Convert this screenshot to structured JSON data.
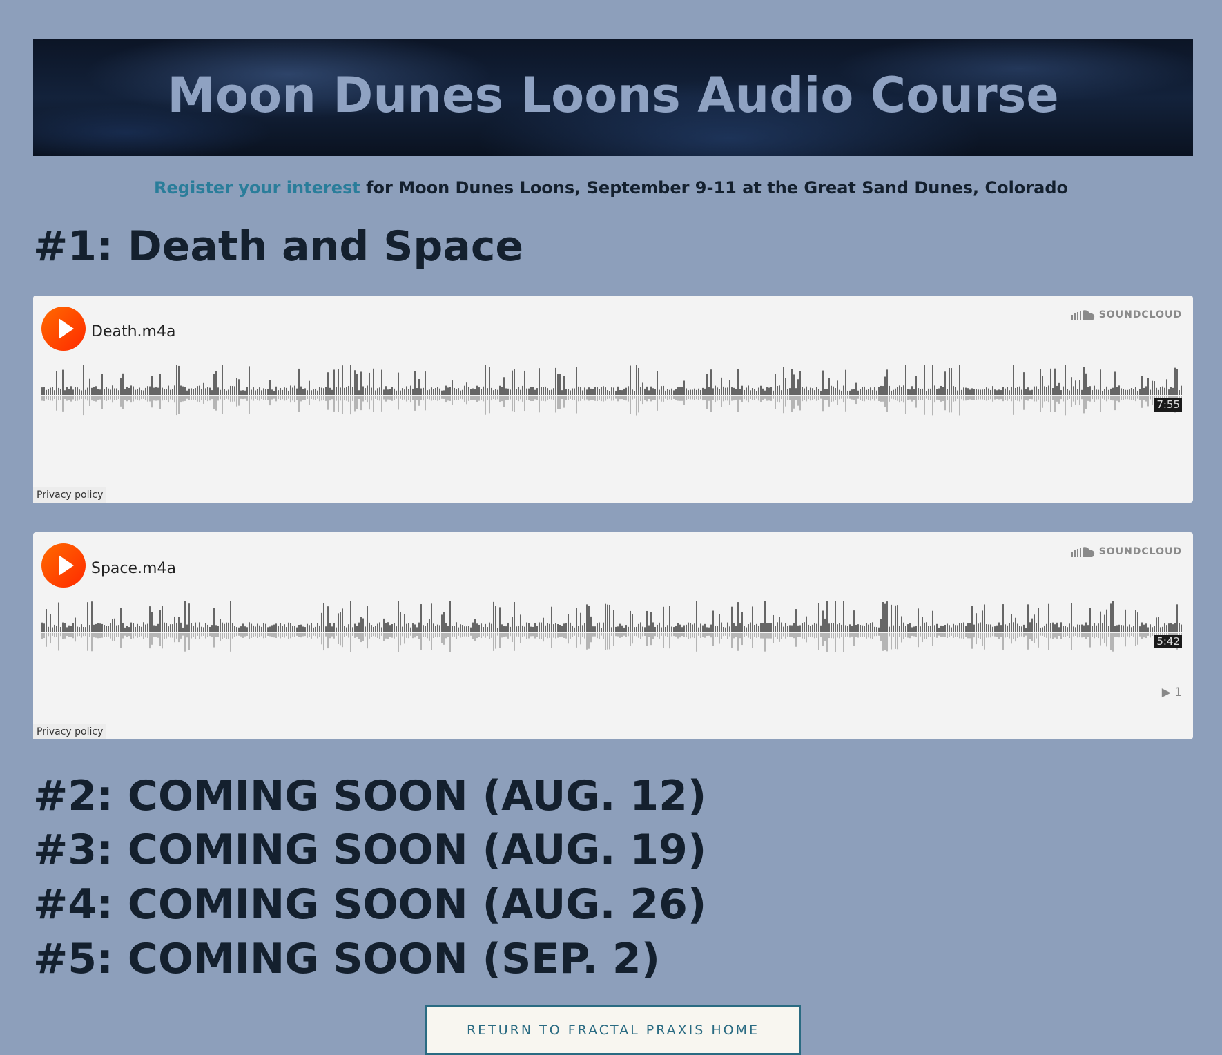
{
  "banner": {
    "title": "Moon Dunes Loons Audio Course"
  },
  "register": {
    "link_text": "Register your interest",
    "rest_text": " for Moon Dunes Loons, September 9-11 at the Great Sand Dunes, Colorado"
  },
  "section1": {
    "title": "#1: Death and Space"
  },
  "players": [
    {
      "track": "Death.m4a",
      "brand": "SOUNDCLOUD",
      "duration": "7:55",
      "plays": "",
      "privacy": "Privacy policy"
    },
    {
      "track": "Space.m4a",
      "brand": "SOUNDCLOUD",
      "duration": "5:42",
      "plays": "1",
      "privacy": "Privacy policy"
    }
  ],
  "coming_soon": [
    "#2: COMING SOON (AUG. 12)",
    "#3: COMING SOON (AUG. 19)",
    "#4: COMING SOON (AUG. 26)",
    "#5: COMING SOON (SEP. 2)"
  ],
  "return_button": {
    "label": "RETURN TO FRACTAL PRAXIS HOME"
  },
  "colors": {
    "background": "#8d9fbb",
    "accent": "#2a7d9a",
    "soundcloud_orange": "#ff5500"
  }
}
